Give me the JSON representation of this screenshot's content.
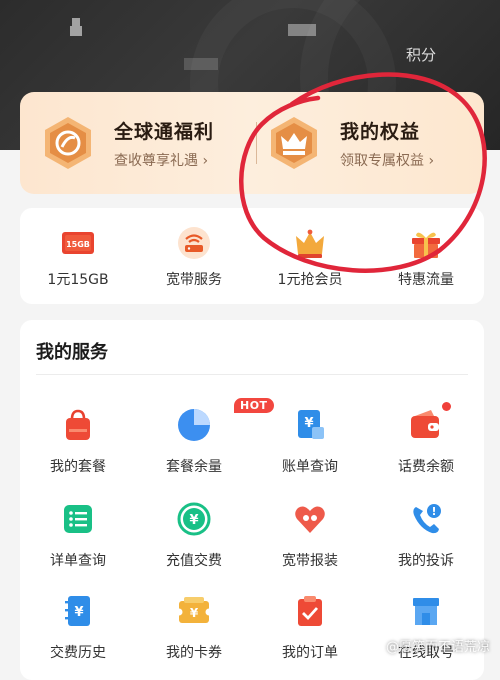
{
  "header": {
    "right_text": "积分"
  },
  "benefits": [
    {
      "title": "全球通福利",
      "subtitle": "查收尊享礼遇",
      "chevron": "›"
    },
    {
      "title": "我的权益",
      "subtitle": "领取专属权益",
      "chevron": "›"
    }
  ],
  "quick": [
    {
      "label": "1元15GB",
      "icon": "sim-card-15gb-icon",
      "badge_text": "15GB"
    },
    {
      "label": "宽带服务",
      "icon": "router-icon"
    },
    {
      "label": "1元抢会员",
      "icon": "crown-icon"
    },
    {
      "label": "特惠流量",
      "icon": "gift-box-icon"
    }
  ],
  "services": {
    "title": "我的服务",
    "hot_badge": "HOT",
    "items": [
      {
        "label": "我的套餐",
        "icon": "bag-icon"
      },
      {
        "label": "套餐余量",
        "icon": "pie-chart-icon"
      },
      {
        "label": "账单查询",
        "icon": "bill-icon",
        "symbol": "¥"
      },
      {
        "label": "话费余额",
        "icon": "wallet-icon"
      },
      {
        "label": "详单查询",
        "icon": "list-icon"
      },
      {
        "label": "充值交费",
        "icon": "recharge-icon",
        "symbol": "¥"
      },
      {
        "label": "宽带报装",
        "icon": "heart-icon"
      },
      {
        "label": "我的投诉",
        "icon": "phone-complaint-icon",
        "symbol": "!"
      },
      {
        "label": "交费历史",
        "icon": "receipt-history-icon",
        "symbol": "¥"
      },
      {
        "label": "我的卡券",
        "icon": "coupon-icon",
        "symbol": "¥"
      },
      {
        "label": "我的订单",
        "icon": "order-icon"
      },
      {
        "label": "在线取号",
        "icon": "shop-icon"
      }
    ]
  },
  "watermark": "@愿笑而不语荒凉",
  "colors": {
    "accent": "#f2473f",
    "gold": "#f0a73a",
    "blue": "#2f8de8",
    "green": "#19c086",
    "annotation": "#e0263a"
  }
}
